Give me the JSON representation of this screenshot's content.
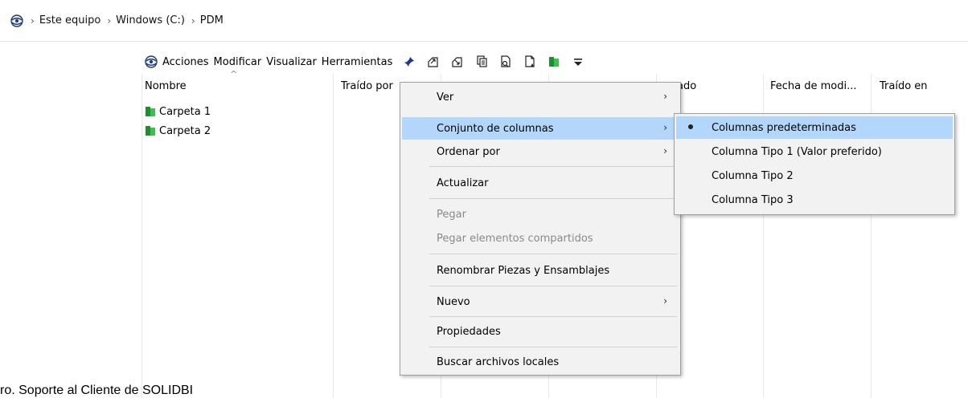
{
  "address": {
    "crumbs": [
      "Este equipo",
      "Windows (C:)",
      "PDM"
    ]
  },
  "toolbar": {
    "menus": [
      "Acciones",
      "Modificar",
      "Visualizar",
      "Herramientas"
    ],
    "icons": [
      "pin-icon",
      "checkout-icon",
      "checkin-icon",
      "copy-icon",
      "search-document-icon",
      "document-icon",
      "green-folder-icon",
      "overflow-icon"
    ]
  },
  "columns": [
    "Nombre",
    "Traído por",
    "",
    "ado",
    "Fecha de modi...",
    "Traído en"
  ],
  "files": [
    "Carpeta 1",
    "Carpeta 2"
  ],
  "context_menu": {
    "items": [
      "Ver",
      "Conjunto de columnas",
      "Ordenar por",
      "Actualizar",
      "Pegar",
      "Pegar elementos compartidos",
      "Renombrar Piezas y Ensamblajes",
      "Nuevo",
      "Propiedades",
      "Buscar archivos locales"
    ],
    "highlighted": "Conjunto de columnas",
    "highlight_color": "#b3d6fb"
  },
  "submenu": {
    "items": [
      "Columnas predeterminadas",
      "Columna Tipo 1 (Valor preferido)",
      "Columna Tipo 2",
      "Columna Tipo 3"
    ],
    "selected": "Columnas predeterminadas"
  },
  "caption": "ro. Soporte al Cliente de SOLIDBI"
}
